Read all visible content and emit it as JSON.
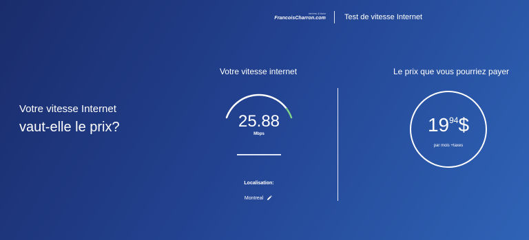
{
  "header": {
    "logo_tagline": "techno & futur",
    "logo_name": "FrancoisCharron.com",
    "title": "Test de vitesse Internet"
  },
  "hero": {
    "line1": "Votre vitesse Internet",
    "line2": "vaut-elle le prix?"
  },
  "speed": {
    "title": "Votre vitesse internet",
    "value": "25.88",
    "unit": "Mbps",
    "gauge_fraction": 0.12,
    "location_label": "Localisation:",
    "location_value": "Montreal"
  },
  "price": {
    "title": "Le prix que vous pourriez payer",
    "dollars": "19",
    "cents": "94",
    "currency": "$",
    "note": "par mois +taxes"
  },
  "colors": {
    "gauge_accent": "#7fd08a",
    "gauge_track": "#ffffff"
  },
  "icons": {
    "edit": "pencil-icon"
  }
}
